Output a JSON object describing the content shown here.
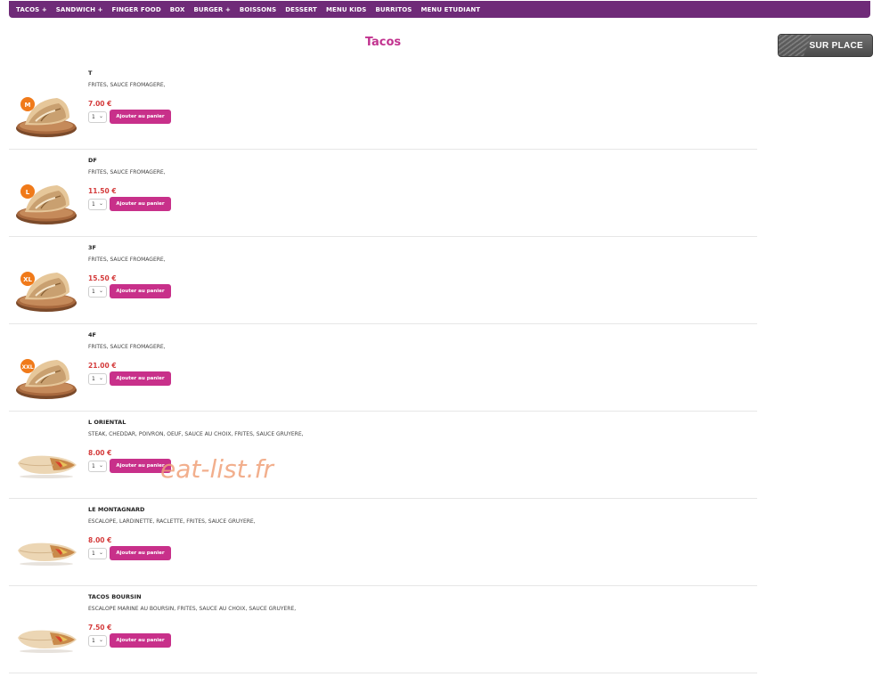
{
  "nav": {
    "items": [
      "TACOS +",
      "SANDWICH +",
      "FINGER FOOD",
      "BOX",
      "BURGER +",
      "BOISSONS",
      "DESSERT",
      "MENU KIDS",
      "BURRITOS",
      "MENU ETUDIANT"
    ]
  },
  "page": {
    "title": "Tacos",
    "sur_place": "SUR PLACE",
    "watermark": "eat-list.fr"
  },
  "products": [
    {
      "name": "T",
      "desc": "FRITES, SAUCE FROMAGERE,",
      "price": "7.00 €",
      "qty": "1",
      "size": "M",
      "kind": "taco-plate"
    },
    {
      "name": "DF",
      "desc": "FRITES, SAUCE FROMAGERE,",
      "price": "11.50 €",
      "qty": "1",
      "size": "L",
      "kind": "taco-plate"
    },
    {
      "name": "3F",
      "desc": "FRITES, SAUCE FROMAGERE,",
      "price": "15.50 €",
      "qty": "1",
      "size": "XL",
      "kind": "taco-plate"
    },
    {
      "name": "4F",
      "desc": "FRITES, SAUCE FROMAGERE,",
      "price": "21.00 €",
      "qty": "1",
      "size": "XXL",
      "kind": "taco-plate"
    },
    {
      "name": "L ORIENTAL",
      "desc": "STEAK, CHEDDAR, POIVRON, OEUF, SAUCE AU CHOIX, FRITES, SAUCE GRUYERE,",
      "price": "8.00 €",
      "qty": "1",
      "size": "",
      "kind": "wrap"
    },
    {
      "name": "LE MONTAGNARD",
      "desc": "ESCALOPE, LARDINETTE, RACLETTE, FRITES, SAUCE GRUYERE,",
      "price": "8.00 €",
      "qty": "1",
      "size": "",
      "kind": "wrap"
    },
    {
      "name": "TACOS BOURSIN",
      "desc": "ESCALOPE MARINE AU BOURSIN, FRITES, SAUCE AU CHOIX, SAUCE GRUYERE,",
      "price": "7.50 €",
      "qty": "1",
      "size": "",
      "kind": "wrap"
    }
  ],
  "add_label": "Ajouter au panier",
  "colors": {
    "nav": "#6f2b78",
    "accent": "#c8308a",
    "price": "#d43b3b",
    "badge": "#f07a1a"
  }
}
